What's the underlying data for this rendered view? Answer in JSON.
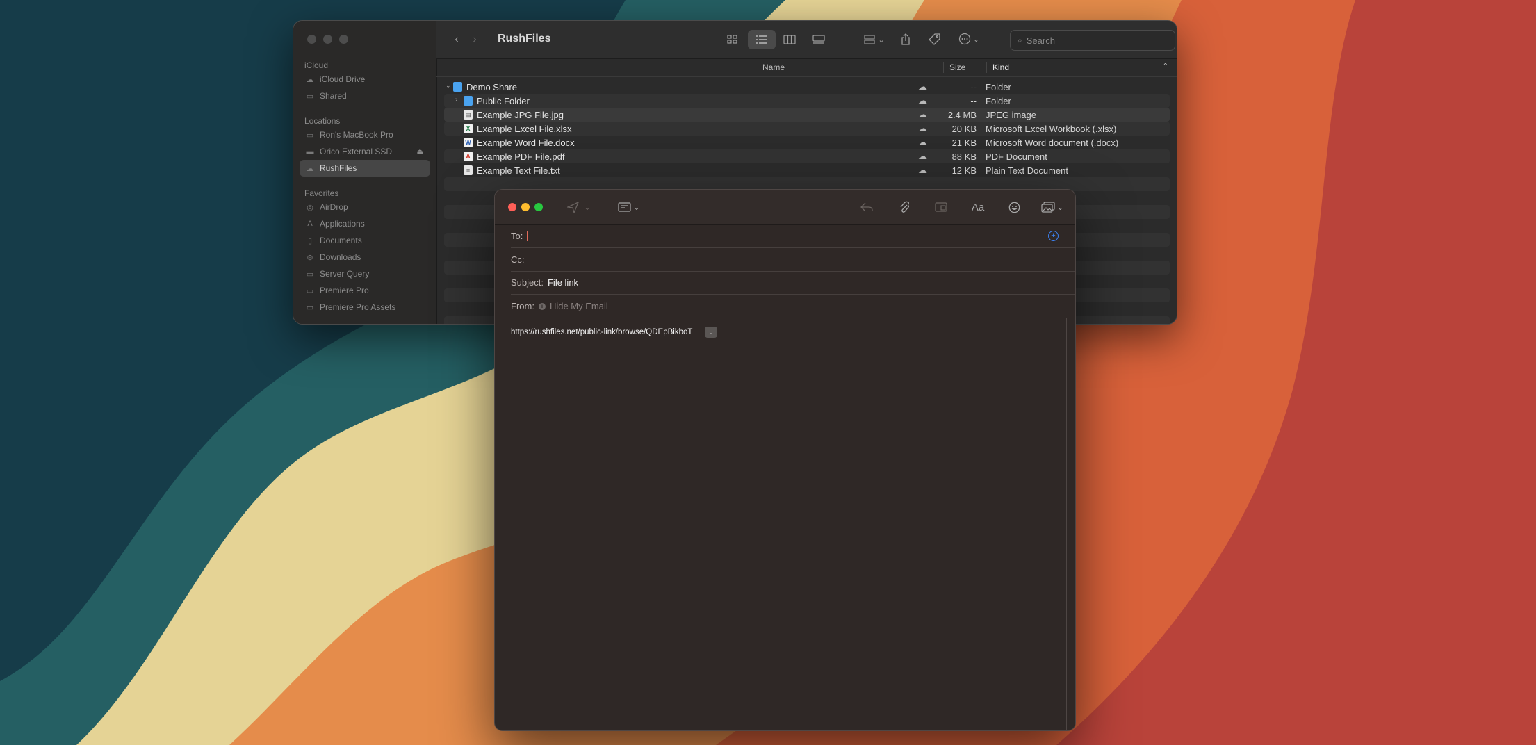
{
  "finder": {
    "title": "RushFiles",
    "search_placeholder": "Search",
    "sidebar": {
      "sections": [
        {
          "title": "iCloud",
          "items": [
            {
              "label": "iCloud Drive",
              "icon": "cloud-icon"
            },
            {
              "label": "Shared",
              "icon": "shared-folder-icon"
            }
          ]
        },
        {
          "title": "Locations",
          "items": [
            {
              "label": "Ron's MacBook Pro",
              "icon": "laptop-icon"
            },
            {
              "label": "Orico External SSD",
              "icon": "drive-icon"
            },
            {
              "label": "RushFiles",
              "icon": "cloud-drive-icon"
            }
          ]
        },
        {
          "title": "Favorites",
          "items": [
            {
              "label": "AirDrop",
              "icon": "airdrop-icon"
            },
            {
              "label": "Applications",
              "icon": "applications-icon"
            },
            {
              "label": "Documents",
              "icon": "document-icon"
            },
            {
              "label": "Downloads",
              "icon": "download-icon"
            },
            {
              "label": "Server Query",
              "icon": "folder-icon"
            },
            {
              "label": "Premiere Pro",
              "icon": "folder-icon"
            },
            {
              "label": "Premiere Pro Assets",
              "icon": "folder-icon"
            }
          ]
        }
      ]
    },
    "columns": {
      "name": "Name",
      "size": "Size",
      "kind": "Kind"
    },
    "files": [
      {
        "name": "Demo Share",
        "size": "--",
        "kind": "Folder"
      },
      {
        "name": "Public Folder",
        "size": "--",
        "kind": "Folder"
      },
      {
        "name": "Example JPG File.jpg",
        "size": "2.4 MB",
        "kind": "JPEG image"
      },
      {
        "name": "Example Excel File.xlsx",
        "size": "20 KB",
        "kind": "Microsoft Excel Workbook (.xlsx)"
      },
      {
        "name": "Example Word File.docx",
        "size": "21 KB",
        "kind": "Microsoft Word document (.docx)"
      },
      {
        "name": "Example PDF File.pdf",
        "size": "88 KB",
        "kind": "PDF Document"
      },
      {
        "name": "Example Text File.txt",
        "size": "12 KB",
        "kind": "Plain Text Document"
      }
    ]
  },
  "mail": {
    "to_label": "To:",
    "cc_label": "Cc:",
    "subject_label": "Subject:",
    "subject_value": "File link",
    "from_label": "From:",
    "from_value": "Hide My Email",
    "font_button": "Aa",
    "body_link": "https://rushfiles.net/public-link/browse/QDEpBikboT"
  },
  "colors": {
    "close": "#ff5f57",
    "minimize": "#febc2e",
    "zoom": "#28c840",
    "accent_blue": "#3d84f7",
    "folder_blue": "#4aa3f0"
  }
}
